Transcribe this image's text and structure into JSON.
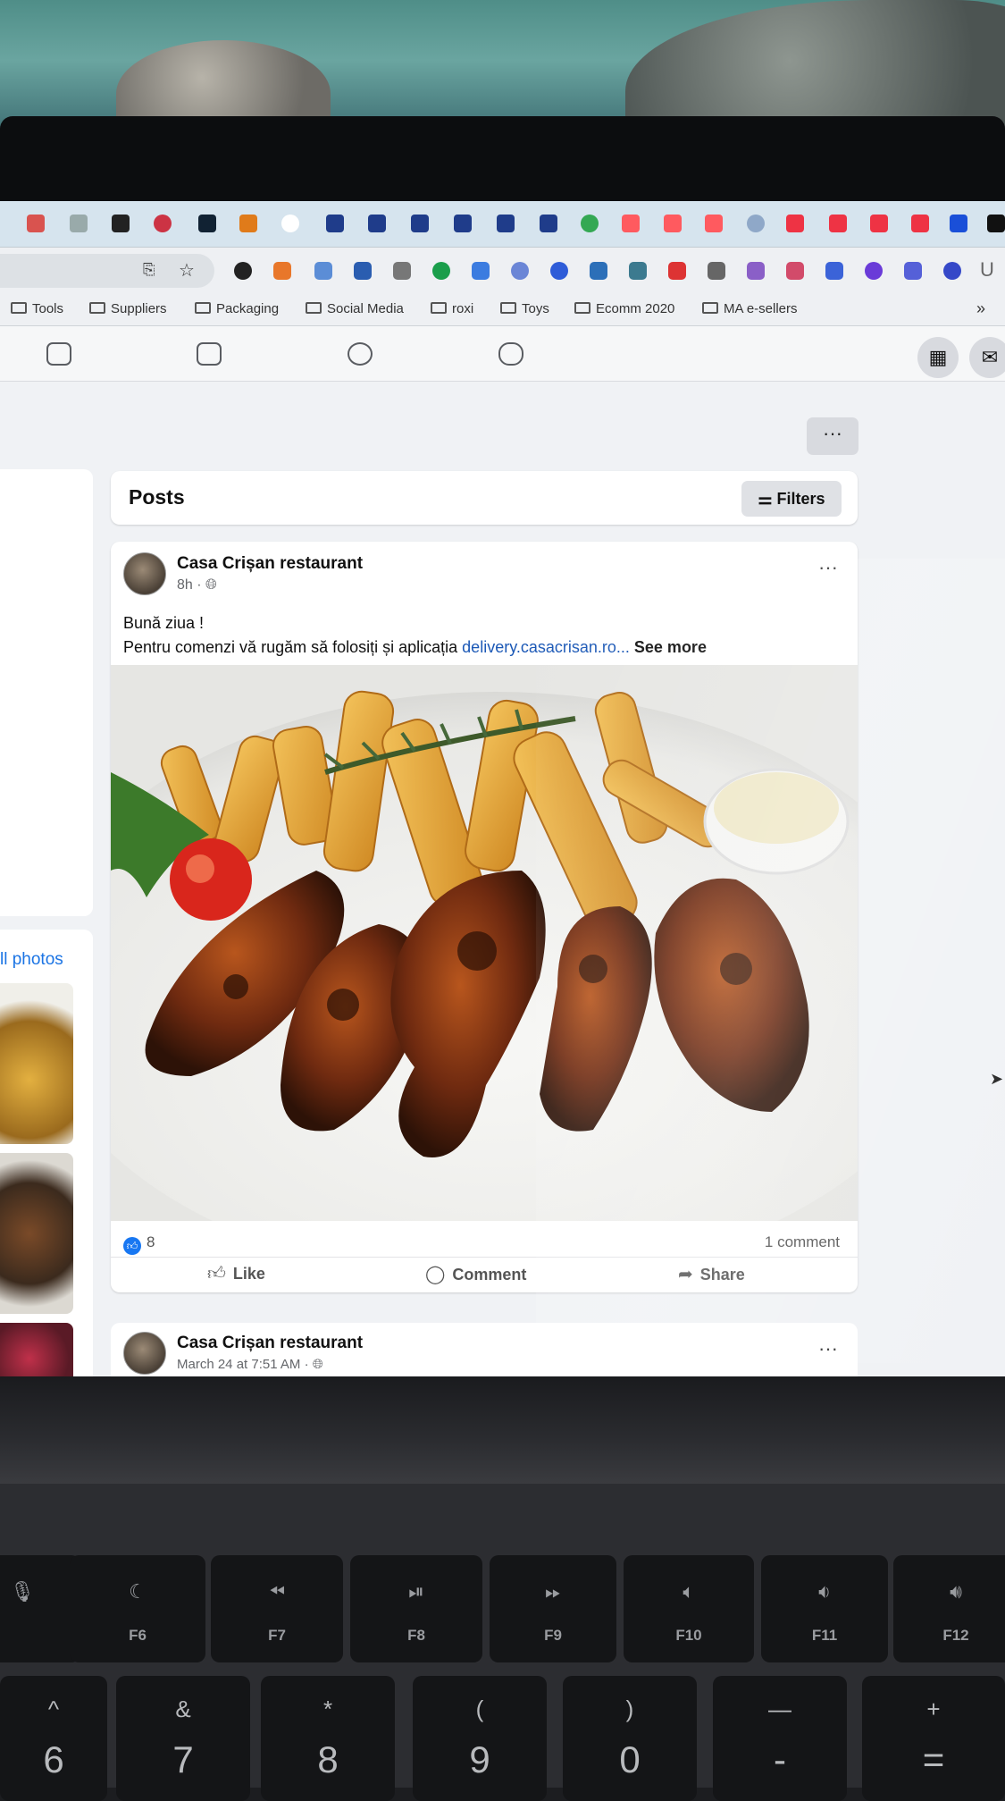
{
  "browser": {
    "bookmarks": [
      {
        "name": "Tools"
      },
      {
        "name": "Suppliers"
      },
      {
        "name": "Packaging"
      },
      {
        "name": "Social Media"
      },
      {
        "name": "roxi"
      },
      {
        "name": "Toys"
      },
      {
        "name": "Ecomm 2020"
      },
      {
        "name": "MA e-sellers"
      }
    ],
    "more_bookmarks": "»"
  },
  "page": {
    "posts_title": "Posts",
    "filters_label": "Filters",
    "more_label": "···",
    "all_photos_label": "ll photos"
  },
  "post": {
    "author": "Casa Crișan restaurant",
    "time": "8h · ",
    "text_line1": "Bună ziua !",
    "text_line2": "Pentru comenzi vă rugăm să folosiți și aplicația ",
    "link": "delivery.casacrisan.ro...",
    "see_more": " See more",
    "reaction_count": "8",
    "comment_count": "1 comment",
    "like_label": "Like",
    "comment_label": "Comment",
    "share_label": "Share"
  },
  "post2": {
    "author": "Casa Crișan restaurant",
    "time": "March 24 at 7:51 AM · "
  },
  "keys": [
    {
      "label": "F6",
      "icon": "moon-icon"
    },
    {
      "label": "F7",
      "icon": "rewind-icon"
    },
    {
      "label": "F8",
      "icon": "play-pause-icon"
    },
    {
      "label": "F9",
      "icon": "fast-forward-icon"
    },
    {
      "label": "F10",
      "icon": "mute-icon"
    },
    {
      "label": "F11",
      "icon": "volume-down-icon"
    },
    {
      "label": "F12",
      "icon": "volume-up-icon"
    }
  ],
  "num_keys": [
    {
      "top": "&",
      "bot": "7"
    },
    {
      "top": "*",
      "bot": "8"
    },
    {
      "top": "(",
      "bot": "9"
    },
    {
      "top": ")",
      "bot": "0"
    },
    {
      "top": "—",
      "bot": "-"
    },
    {
      "top": "+",
      "bot": "="
    }
  ],
  "colors": {
    "facebook_blue": "#1877f2",
    "link_blue": "#1b58b6",
    "page_bg": "#f0f2f5"
  }
}
